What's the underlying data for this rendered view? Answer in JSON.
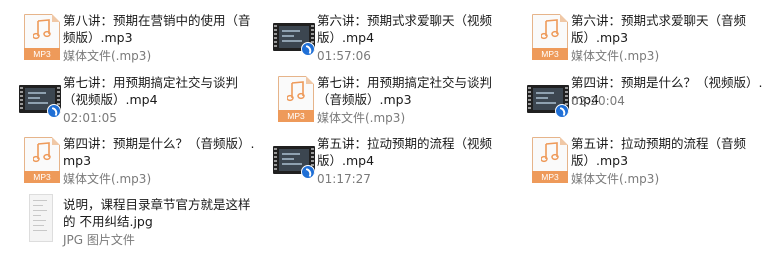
{
  "files": [
    {
      "name": "第八讲：预期在营销中的使用（音频版）.mp3",
      "meta": "媒体文件(.mp3)",
      "icon": "mp3-file-icon",
      "icon_label": "MP3"
    },
    {
      "name": "第六讲：预期式求爱聊天（视频版）.mp4",
      "meta": "01:57:06",
      "icon": "video-file-icon"
    },
    {
      "name": "第六讲：预期式求爱聊天（音频版）.mp3",
      "meta": "媒体文件(.mp3)",
      "icon": "mp3-file-icon",
      "icon_label": "MP3"
    },
    {
      "name": "第七讲：用预期搞定社交与谈判（视频版）.mp4",
      "meta": "02:01:05",
      "icon": "video-file-icon"
    },
    {
      "name": "第七讲：用预期搞定社交与谈判（音频版）.mp3",
      "meta": "媒体文件(.mp3)",
      "icon": "mp3-file-icon",
      "icon_label": "MP3"
    },
    {
      "name": "第四讲：预期是什么？（视频版）.mp4",
      "meta": "02:20:04",
      "icon": "video-file-icon"
    },
    {
      "name": "第四讲：预期是什么？（音频版）.mp3",
      "meta": "媒体文件(.mp3)",
      "icon": "mp3-file-icon",
      "icon_label": "MP3"
    },
    {
      "name": "第五讲：拉动预期的流程（视频版）.mp4",
      "meta": "01:17:27",
      "icon": "video-file-icon"
    },
    {
      "name": "第五讲：拉动预期的流程（音频版）.mp3",
      "meta": "媒体文件(.mp3)",
      "icon": "mp3-file-icon",
      "icon_label": "MP3"
    },
    {
      "name": "说明，课程目录章节官方就是这样的 不用纠结.jpg",
      "meta": "JPG 图片文件",
      "icon": "image-file-icon"
    }
  ],
  "colors": {
    "mp3_band": "#ee9a5a",
    "mp3_note": "#ee9a5a",
    "sync_badge": "#1f6fd6",
    "meta_text": "#7a7a7a"
  }
}
